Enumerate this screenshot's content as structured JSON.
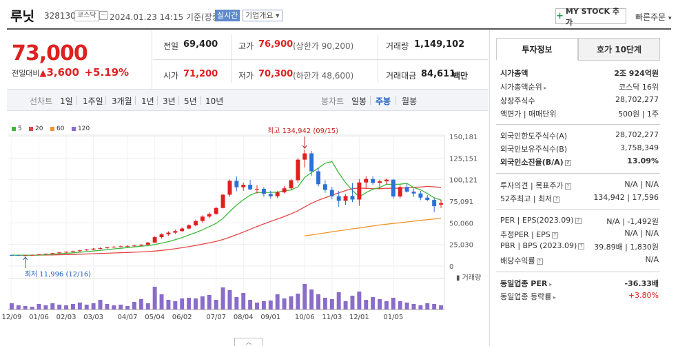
{
  "header": {
    "name": "루닛",
    "code": "328130",
    "market": "코스닥",
    "datetime": "2024.01.23 14:15 기준(장중)",
    "realtime": "실시간",
    "overview": "기업개요",
    "mystock": "MY STOCK 추가",
    "quick_order": "빠른주문"
  },
  "price": {
    "current": "73,000",
    "change_label": "전일대비",
    "change_amount": "3,600",
    "change_pct": "+5.19%"
  },
  "quote": {
    "prev_label": "전일",
    "prev": "69,400",
    "high_label": "고가",
    "high": "76,900",
    "upper_limit": "(상한가 90,200)",
    "volume_label": "거래량",
    "volume": "1,149,102",
    "open_label": "시가",
    "open": "71,200",
    "low_label": "저가",
    "low": "70,300",
    "lower_limit": "(하한가 48,600)",
    "amount_label": "거래대금",
    "amount": "84,611",
    "amount_unit": "백만"
  },
  "period_bar": {
    "line_label": "선차트",
    "periods": [
      "1일",
      "1주일",
      "3개월",
      "1년",
      "3년",
      "5년",
      "10년"
    ],
    "candle_label": "봉차트",
    "candles": [
      "일봉",
      "주봉",
      "월봉"
    ],
    "active_candle": "주봉"
  },
  "chart_data": {
    "type": "candlestick",
    "legend": [
      {
        "name": "5",
        "color": "#3cb93c"
      },
      {
        "name": "20",
        "color": "#e74545"
      },
      {
        "name": "60",
        "color": "#f0962d"
      },
      {
        "name": "120",
        "color": "#8a6cc9"
      }
    ],
    "y_ticks": [
      "150,181",
      "125,151",
      "100,121",
      "75,091",
      "50,060",
      "25,030",
      "0"
    ],
    "ylim": [
      0,
      150181
    ],
    "x_ticks": [
      "12/09",
      "01/06",
      "02/03",
      "03/03",
      "04/07",
      "05/04",
      "06/02",
      "07/07",
      "08/04",
      "09/01",
      "10/06",
      "11/03",
      "12/01",
      "01/05"
    ],
    "high_annotation": "최고 134,942 (09/15)",
    "low_annotation": "최저 11,996 (12/16)",
    "volume_label": "거래량",
    "candles": [
      [
        12800,
        13400,
        12000,
        12700
      ],
      [
        12700,
        13200,
        12100,
        12300
      ],
      [
        12300,
        12900,
        11996,
        12500
      ],
      [
        12500,
        13300,
        12200,
        13000
      ],
      [
        13000,
        13800,
        12600,
        13500
      ],
      [
        13500,
        14500,
        13200,
        14200
      ],
      [
        14200,
        15300,
        13800,
        15000
      ],
      [
        15000,
        16200,
        14600,
        15800
      ],
      [
        15800,
        17000,
        15300,
        16500
      ],
      [
        16500,
        17900,
        16100,
        17300
      ],
      [
        17300,
        18700,
        16800,
        18200
      ],
      [
        18200,
        19800,
        17700,
        19100
      ],
      [
        19100,
        20900,
        18600,
        20200
      ],
      [
        20200,
        21600,
        19300,
        20700
      ],
      [
        20700,
        22400,
        20100,
        21600
      ],
      [
        21600,
        23400,
        21000,
        22400
      ],
      [
        22400,
        23800,
        21700,
        22900
      ],
      [
        22900,
        24100,
        22000,
        23300
      ],
      [
        23300,
        24500,
        22600,
        23800
      ],
      [
        23800,
        25500,
        23200,
        24700
      ],
      [
        24700,
        28000,
        24200,
        27200
      ],
      [
        27200,
        34500,
        26800,
        33500
      ],
      [
        33500,
        37900,
        32000,
        36800
      ],
      [
        36800,
        40200,
        35300,
        38700
      ],
      [
        38700,
        42200,
        37100,
        40500
      ],
      [
        40500,
        45000,
        39600,
        43500
      ],
      [
        43500,
        48500,
        42500,
        47200
      ],
      [
        47200,
        53800,
        46100,
        52100
      ],
      [
        52100,
        58800,
        50100,
        57300
      ],
      [
        57300,
        62200,
        55200,
        60400
      ],
      [
        60400,
        68800,
        59400,
        67300
      ],
      [
        67300,
        83800,
        66700,
        82700
      ],
      [
        82700,
        100200,
        80400,
        98800
      ],
      [
        98800,
        103800,
        86700,
        91300
      ],
      [
        91300,
        96800,
        87200,
        94200
      ],
      [
        94200,
        99900,
        88200,
        88900
      ],
      [
        88900,
        93700,
        84100,
        89500
      ],
      [
        89500,
        91500,
        80400,
        83600
      ],
      [
        83600,
        87300,
        78200,
        80900
      ],
      [
        80900,
        86800,
        78700,
        85400
      ],
      [
        85400,
        92800,
        84200,
        90100
      ],
      [
        90100,
        100900,
        87700,
        99500
      ],
      [
        99500,
        125300,
        96600,
        123300
      ],
      [
        123300,
        134942,
        114200,
        130600
      ],
      [
        130600,
        133300,
        104400,
        109800
      ],
      [
        109800,
        113600,
        92100,
        94800
      ],
      [
        94800,
        99400,
        84900,
        88200
      ],
      [
        88200,
        91800,
        77300,
        80900
      ],
      [
        80900,
        87100,
        68600,
        75700
      ],
      [
        75700,
        83600,
        70900,
        81200
      ],
      [
        81200,
        96300,
        74100,
        77100
      ],
      [
        77100,
        100600,
        69900,
        96900
      ],
      [
        96900,
        103900,
        89800,
        100900
      ],
      [
        100900,
        104200,
        93900,
        96400
      ],
      [
        96400,
        100200,
        89200,
        98200
      ],
      [
        98200,
        101400,
        94800,
        100100
      ],
      [
        100100,
        101200,
        78200,
        80600
      ],
      [
        80600,
        93800,
        78600,
        91600
      ],
      [
        91600,
        95100,
        85100,
        86300
      ],
      [
        86300,
        89900,
        80300,
        84100
      ],
      [
        84100,
        87100,
        76300,
        79300
      ],
      [
        79300,
        82300,
        75300,
        76600
      ],
      [
        76600,
        79200,
        62200,
        69400
      ],
      [
        71200,
        76900,
        67300,
        73000
      ]
    ],
    "volumes": [
      9,
      6,
      5,
      4,
      8,
      6,
      9,
      7,
      6,
      8,
      10,
      7,
      9,
      14,
      8,
      6,
      7,
      5,
      11,
      15,
      9,
      33,
      22,
      14,
      12,
      16,
      17,
      16,
      19,
      21,
      14,
      32,
      28,
      18,
      24,
      14,
      10,
      12,
      13,
      22,
      16,
      19,
      23,
      37,
      29,
      22,
      17,
      15,
      25,
      12,
      20,
      26,
      14,
      18,
      15,
      12,
      17,
      12,
      10,
      8,
      6,
      9,
      8,
      6
    ],
    "ma5": [
      12620,
      12660,
      12660,
      12680,
      12800,
      13080,
      13640,
      14200,
      14800,
      15360,
      16000,
      16680,
      17420,
      18180,
      18920,
      19860,
      20640,
      21380,
      22180,
      23000,
      23700,
      24900,
      26500,
      28240,
      30500,
      33020,
      35920,
      38780,
      42060,
      45720,
      49480,
      55280,
      63180,
      70620,
      76860,
      82200,
      85400,
      85280,
      85400,
      85620,
      87080,
      88160,
      91920,
      102660,
      108300,
      113620,
      119260,
      121000,
      107820,
      96520,
      87680,
      80300,
      85160,
      89100,
      90940,
      94800,
      94700,
      94920,
      95760,
      90920,
      88380,
      84020,
      79080,
      76480
    ],
    "ma20": [
      12700,
      12680,
      12630,
      12640,
      12690,
      12780,
      12910,
      13080,
      13260,
      13460,
      13710,
      13970,
      14260,
      14560,
      14860,
      15180,
      15460,
      15750,
      16050,
      16390,
      16740,
      17300,
      18110,
      19050,
      20090,
      21210,
      22470,
      23870,
      25410,
      26980,
      28620,
      30760,
      33480,
      36380,
      39360,
      42540,
      45870,
      48800,
      51650,
      54450,
      57450,
      60520,
      64080,
      68550,
      72800,
      76270,
      79190,
      81970,
      84800,
      87450,
      89690,
      90420,
      90050,
      89750,
      89640,
      90190,
      90140,
      90210,
      90700,
      91200,
      91600,
      92290,
      91890,
      90880
    ],
    "ma60_from": 43,
    "ma60": [
      35000,
      36100,
      37200,
      38400,
      39700,
      40800,
      41900,
      43100,
      44100,
      45300,
      46500,
      47600,
      48500,
      49400,
      50200,
      51100,
      52000,
      52900,
      53800,
      54600,
      55500
    ]
  },
  "right_panel": {
    "tabs": [
      "투자정보",
      "호가 10단계"
    ],
    "rows": [
      {
        "label": "시가총액",
        "value": "2조 924억원",
        "bold": true
      },
      {
        "label": "시가총액순위",
        "value": "코스닥 16위"
      },
      {
        "label": "상장주식수",
        "value": "28,702,277"
      },
      {
        "label": "액면가 | 매매단위",
        "value": "500원 | 1주"
      },
      {
        "label": "외국인한도주식수(A)",
        "value": "28,702,277"
      },
      {
        "label": "외국인보유주식수(B)",
        "value": "3,758,349"
      },
      {
        "label": "외국인소진율(B/A)",
        "value": "13.09%",
        "bold": true
      },
      {
        "label": "투자의견 | 목표주가",
        "value": "N/A | N/A"
      },
      {
        "label": "52주최고 | 최저",
        "value": "134,942 | 17,596"
      },
      {
        "label": "PER | EPS(2023.09)",
        "value": "N/A | -1,492원"
      },
      {
        "label": "추정PER | EPS",
        "value": "N/A | N/A"
      },
      {
        "label": "PBR | BPS (2023.09)",
        "value": "39.89배 | 1,830원"
      },
      {
        "label": "배당수익률",
        "value": "N/A"
      },
      {
        "label": "동일업종 PER",
        "value": "-36.33배",
        "bold": true
      },
      {
        "label": "동일업종 등락률",
        "value": "+3.80%"
      }
    ]
  },
  "toggle": "︿"
}
